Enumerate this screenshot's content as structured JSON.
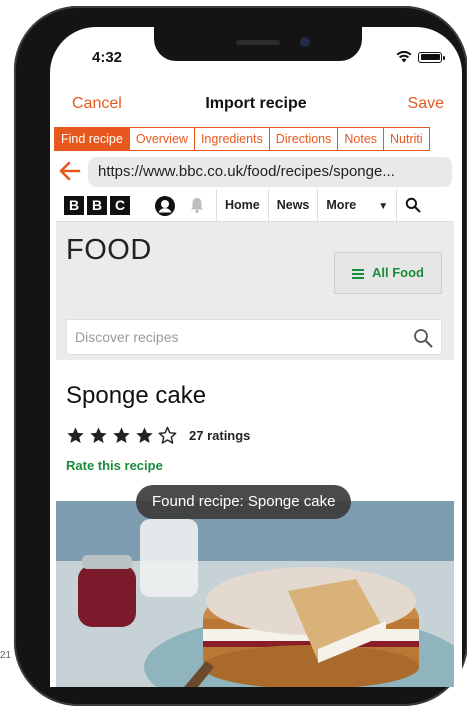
{
  "status_bar": {
    "time": "4:32"
  },
  "nav": {
    "cancel": "Cancel",
    "title": "Import recipe",
    "save": "Save"
  },
  "tabs": [
    {
      "label": "Find recipe",
      "active": true
    },
    {
      "label": "Overview"
    },
    {
      "label": "Ingredients"
    },
    {
      "label": "Directions"
    },
    {
      "label": "Notes"
    },
    {
      "label": "Nutriti"
    }
  ],
  "browser": {
    "url": "https://www.bbc.co.uk/food/recipes/sponge..."
  },
  "bbc": {
    "logo_letters": [
      "B",
      "B",
      "C"
    ],
    "nav": {
      "home": "Home",
      "news": "News",
      "more": "More"
    }
  },
  "food": {
    "title": "FOOD",
    "all_food": "All Food",
    "search_placeholder": "Discover recipes"
  },
  "recipe": {
    "title": "Sponge cake",
    "rating_stars": 4,
    "rating_max": 5,
    "ratings_count": "27 ratings",
    "rate_link": "Rate this recipe"
  },
  "toast": "Found recipe: Sponge cake",
  "corner_label": "21",
  "colors": {
    "accent": "#e8581e",
    "bbc_green": "#1a8c3c"
  }
}
